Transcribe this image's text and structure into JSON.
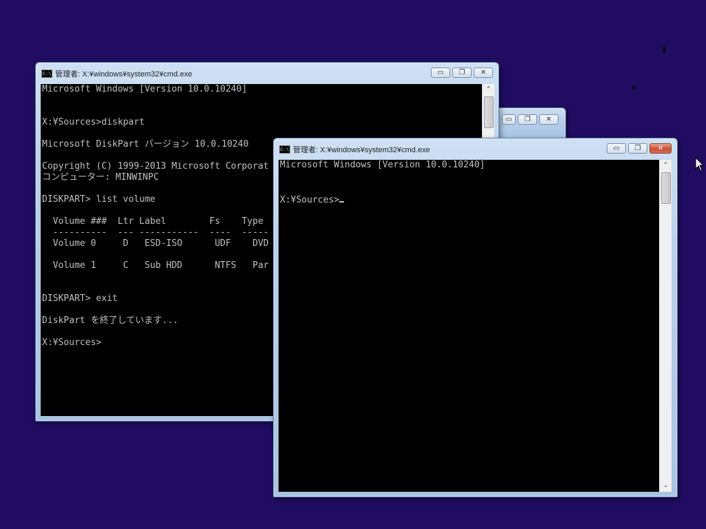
{
  "colors": {
    "desktop": "#200d62",
    "console_bg": "#000000",
    "console_text": "#c0c0c0"
  },
  "back_window": {
    "title": "管理者: X:¥windows¥system32¥cmd.exe",
    "icon_text": "C:\\",
    "lines": [
      "Microsoft Windows [Version 10.0.10240]",
      "",
      "",
      "X:¥Sources>diskpart",
      "",
      "Microsoft DiskPart バージョン 10.0.10240",
      "",
      "Copyright (C) 1999-2013 Microsoft Corporat",
      "コンピューター: MINWINPC",
      "",
      "DISKPART> list volume",
      "",
      "  Volume ###  Ltr Label        Fs    Type",
      "  ----------  --- -----------  ----  -----",
      "  Volume 0     D   ESD-ISO      UDF    DVD",
      "",
      "  Volume 1     C   Sub HDD      NTFS   Par",
      "",
      "",
      "DISKPART> exit",
      "",
      "DiskPart を終了しています...",
      "",
      "X:¥Sources>"
    ]
  },
  "front_window": {
    "title": "管理者: X:¥windows¥system32¥cmd.exe",
    "icon_text": "C:\\",
    "lines": [
      "Microsoft Windows [Version 10.0.10240]",
      "",
      "",
      "X:¥Sources>"
    ]
  },
  "controls": {
    "minimize": "▭",
    "maximize": "❐",
    "close": "✕"
  },
  "scroll": {
    "up": "⌃",
    "down": "⌄"
  }
}
